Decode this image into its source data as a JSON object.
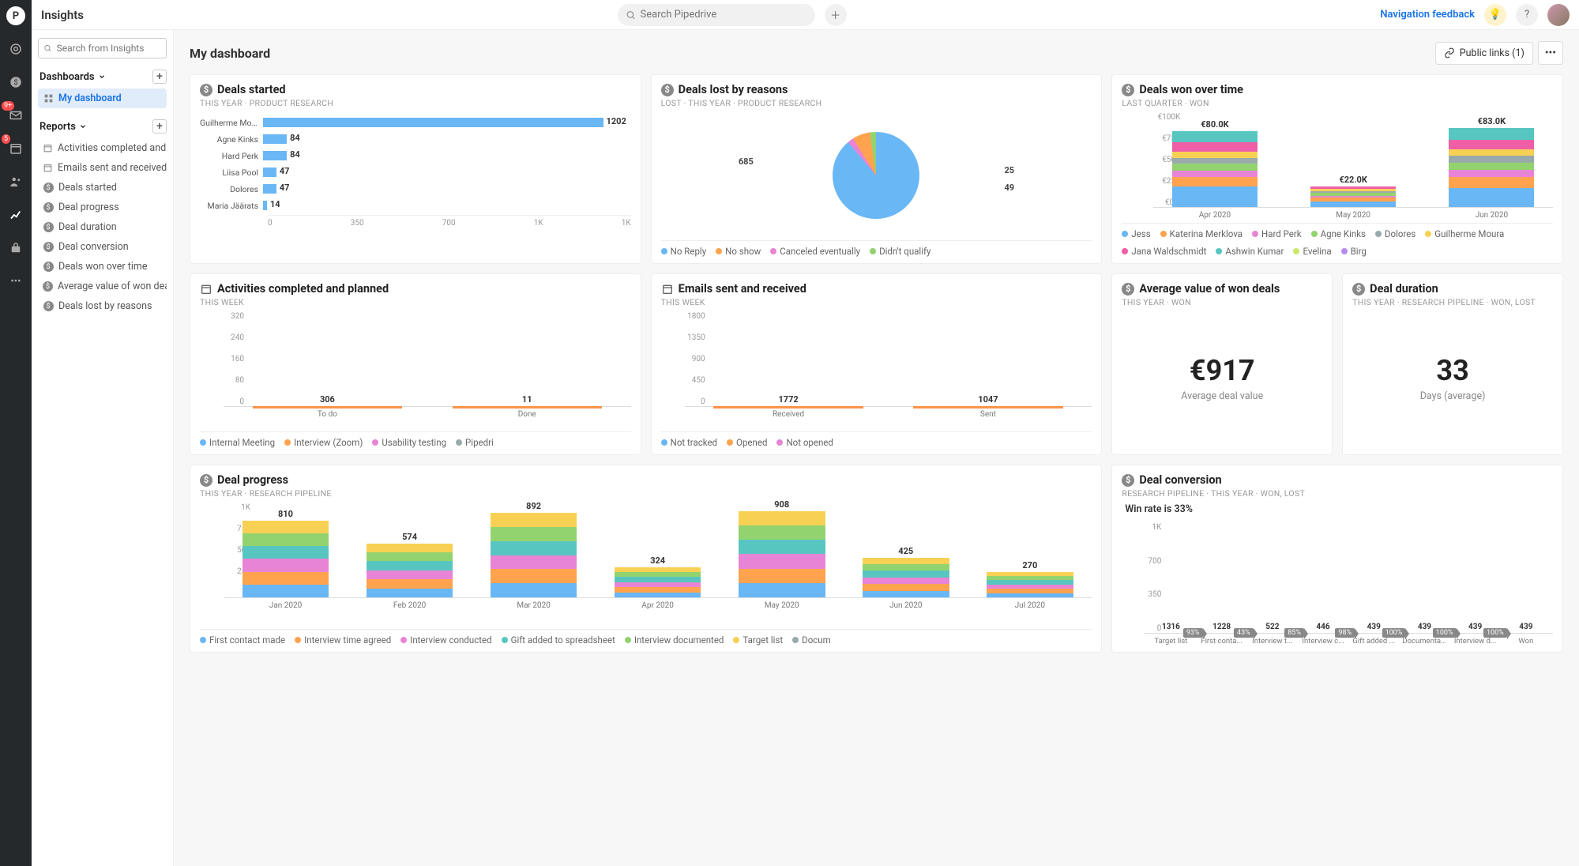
{
  "topbar": {
    "app_title": "Insights",
    "search_placeholder": "Search Pipedrive",
    "feedback": "Navigation feedback",
    "mail_badge": "9+",
    "cal_badge": "5"
  },
  "sidebar": {
    "search_placeholder": "Search from Insights",
    "dashboards_label": "Dashboards",
    "reports_label": "Reports",
    "dashboard_items": [
      {
        "label": "My dashboard",
        "active": true
      }
    ],
    "report_items": [
      {
        "label": "Activities completed and ...",
        "icon": "cal"
      },
      {
        "label": "Emails sent and received",
        "icon": "cal"
      },
      {
        "label": "Deals started",
        "icon": "coin"
      },
      {
        "label": "Deal progress",
        "icon": "coin"
      },
      {
        "label": "Deal duration",
        "icon": "coin"
      },
      {
        "label": "Deal conversion",
        "icon": "coin"
      },
      {
        "label": "Deals won over time",
        "icon": "coin"
      },
      {
        "label": "Average value of won deals",
        "icon": "coin"
      },
      {
        "label": "Deals lost by reasons",
        "icon": "coin"
      }
    ]
  },
  "content": {
    "title": "My dashboard",
    "public_links": "Public links (1)"
  },
  "cards": {
    "deals_started": {
      "title": "Deals started",
      "subtitle": "THIS YEAR   ·   PRODUCT RESEARCH",
      "axis": [
        "0",
        "350",
        "700",
        "1K",
        "1K"
      ],
      "rows": [
        {
          "name": "Guilherme Moura",
          "val": 1202
        },
        {
          "name": "Agne Kinks",
          "val": 84
        },
        {
          "name": "Hard Perk",
          "val": 84
        },
        {
          "name": "Liisa Pool",
          "val": 47
        },
        {
          "name": "Dolores",
          "val": 47
        },
        {
          "name": "Maria Jäärats",
          "val": 14
        }
      ]
    },
    "deals_lost": {
      "title": "Deals lost by reasons",
      "subtitle": "LOST   ·   THIS YEAR   ·   PRODUCT RESEARCH",
      "labels": {
        "a": "685",
        "b": "25",
        "c": "49"
      },
      "legend": [
        {
          "c": "#6ab7f5",
          "t": "No Reply"
        },
        {
          "c": "#ffa34f",
          "t": "No show"
        },
        {
          "c": "#e884d6",
          "t": "Canceled eventually"
        },
        {
          "c": "#93d36f",
          "t": "Didn't qualify"
        }
      ]
    },
    "deals_won": {
      "title": "Deals won over time",
      "subtitle": "LAST QUARTER   ·   WON",
      "ylabels": [
        "€100K",
        "€75K",
        "€50K",
        "€25K",
        "€0.0"
      ],
      "cols": [
        {
          "x": "Apr 2020",
          "val": "€80.0K",
          "h": 80,
          "segs": [
            22,
            10,
            6,
            8,
            6,
            6,
            10,
            12
          ]
        },
        {
          "x": "May 2020",
          "val": "€22.0K",
          "h": 22,
          "segs": [
            6,
            4,
            2,
            3,
            2,
            2,
            3
          ]
        },
        {
          "x": "Jun 2020",
          "val": "€83.0K",
          "h": 83,
          "segs": [
            20,
            12,
            7,
            8,
            7,
            7,
            10,
            12
          ]
        }
      ],
      "legend": [
        {
          "c": "#6ab7f5",
          "t": "Jess"
        },
        {
          "c": "#ffa34f",
          "t": "Katerina Merklova"
        },
        {
          "c": "#e884d6",
          "t": "Hard Perk"
        },
        {
          "c": "#93d36f",
          "t": "Agne Kinks"
        },
        {
          "c": "#9aa",
          "t": "Dolores"
        },
        {
          "c": "#f8d154",
          "t": "Guilherme Moura"
        },
        {
          "c": "#ef5fa7",
          "t": "Jana Waldschmidt"
        },
        {
          "c": "#58c6c0",
          "t": "Ashwin Kumar"
        },
        {
          "c": "#c8e96b",
          "t": "Evelina"
        },
        {
          "c": "#b58cf2",
          "t": "Birg"
        }
      ]
    },
    "activities": {
      "title": "Activities completed and planned",
      "subtitle": "THIS WEEK",
      "ylabels": [
        "320",
        "240",
        "160",
        "80",
        "0"
      ],
      "cols": [
        {
          "x": "To do",
          "val": "306",
          "h": 96
        },
        {
          "x": "Done",
          "val": "11",
          "h": 6
        }
      ],
      "legend": [
        {
          "c": "#6ab7f5",
          "t": "Internal Meeting"
        },
        {
          "c": "#ffa34f",
          "t": "Interview (Zoom)"
        },
        {
          "c": "#e884d6",
          "t": "Usability testing"
        },
        {
          "c": "#9aa",
          "t": "Pipedri"
        }
      ]
    },
    "emails": {
      "title": "Emails sent and received",
      "subtitle": "THIS WEEK",
      "ylabels": [
        "1800",
        "1350",
        "900",
        "450",
        "0"
      ],
      "cols": [
        {
          "x": "Received",
          "val": "1772",
          "h": 98
        },
        {
          "x": "Sent",
          "val": "1047",
          "h": 58
        }
      ],
      "legend": [
        {
          "c": "#6ab7f5",
          "t": "Not tracked"
        },
        {
          "c": "#ffa34f",
          "t": "Opened"
        },
        {
          "c": "#e884d6",
          "t": "Not opened"
        }
      ]
    },
    "avg_value": {
      "title": "Average value of won deals",
      "subtitle": "THIS YEAR   ·   WON",
      "value": "€917",
      "label": "Average deal value"
    },
    "duration": {
      "title": "Deal duration",
      "subtitle": "THIS YEAR   ·   RESEARCH PIPELINE   ·   WON, LOST",
      "value": "33",
      "label": "Days (average)"
    },
    "progress": {
      "title": "Deal progress",
      "subtitle": "THIS YEAR   ·   RESEARCH PIPELINE",
      "ylabels": [
        "1K",
        "750",
        "500",
        "250",
        "0"
      ],
      "cols": [
        {
          "x": "Jan 2020",
          "val": "810",
          "h": 81
        },
        {
          "x": "Feb 2020",
          "val": "574",
          "h": 57
        },
        {
          "x": "Mar 2020",
          "val": "892",
          "h": 89
        },
        {
          "x": "Apr 2020",
          "val": "324",
          "h": 32
        },
        {
          "x": "May 2020",
          "val": "908",
          "h": 91
        },
        {
          "x": "Jun 2020",
          "val": "425",
          "h": 42
        },
        {
          "x": "Jul 2020",
          "val": "270",
          "h": 27
        }
      ],
      "legend": [
        {
          "c": "#6ab7f5",
          "t": "First contact made"
        },
        {
          "c": "#ffa34f",
          "t": "Interview time agreed"
        },
        {
          "c": "#e884d6",
          "t": "Interview conducted"
        },
        {
          "c": "#58c6c0",
          "t": "Gift added to spreadsheet"
        },
        {
          "c": "#93d36f",
          "t": "Interview documented"
        },
        {
          "c": "#f8d154",
          "t": "Target list"
        },
        {
          "c": "#9aa",
          "t": "Docum"
        }
      ]
    },
    "conversion": {
      "title": "Deal conversion",
      "subtitle": "RESEARCH PIPELINE   ·   THIS YEAR   ·   WON, LOST",
      "win_rate": "Win rate is 33%",
      "ylabels": [
        "1K",
        "700",
        "350",
        "0"
      ],
      "cols": [
        {
          "x": "Target list",
          "val": "1316",
          "h": 100,
          "pct": "93%"
        },
        {
          "x": "First conta...",
          "val": "1228",
          "h": 93,
          "pct": "43%"
        },
        {
          "x": "Interview t...",
          "val": "522",
          "h": 40,
          "pct": "85%"
        },
        {
          "x": "Interview c...",
          "val": "446",
          "h": 34,
          "pct": "98%"
        },
        {
          "x": "Gift added ...",
          "val": "439",
          "h": 33,
          "pct": "100%"
        },
        {
          "x": "Documentati...",
          "val": "439",
          "h": 33,
          "pct": "100%"
        },
        {
          "x": "Interview d...",
          "val": "439",
          "h": 33,
          "pct": "100%"
        },
        {
          "x": "Won",
          "val": "439",
          "h": 33,
          "pct": null,
          "green": true
        }
      ]
    }
  },
  "chart_data": [
    {
      "type": "bar",
      "title": "Deals started",
      "orientation": "horizontal",
      "categories": [
        "Guilherme Moura",
        "Agne Kinks",
        "Hard Perk",
        "Liisa Pool",
        "Dolores",
        "Maria Jäärats"
      ],
      "values": [
        1202,
        84,
        84,
        47,
        47,
        14
      ],
      "xlim": [
        0,
        1200
      ]
    },
    {
      "type": "pie",
      "title": "Deals lost by reasons",
      "categories": [
        "No Reply",
        "No show",
        "Canceled eventually",
        "Didn't qualify"
      ],
      "values": [
        685,
        49,
        25,
        0
      ],
      "annotations": [
        "685",
        "25",
        "49"
      ]
    },
    {
      "type": "bar",
      "title": "Deals won over time",
      "stacked": true,
      "categories": [
        "Apr 2020",
        "May 2020",
        "Jun 2020"
      ],
      "totals": [
        80000,
        22000,
        83000
      ],
      "ylabel": "€",
      "ylim": [
        0,
        100000
      ],
      "series_names": [
        "Jess",
        "Katerina Merklova",
        "Hard Perk",
        "Agne Kinks",
        "Dolores",
        "Guilherme Moura",
        "Jana Waldschmidt",
        "Ashwin Kumar",
        "Evelina",
        "Birg"
      ]
    },
    {
      "type": "bar",
      "title": "Activities completed and planned",
      "categories": [
        "To do",
        "Done"
      ],
      "values": [
        306,
        11
      ],
      "ylim": [
        0,
        320
      ],
      "series_names": [
        "Internal Meeting",
        "Interview (Zoom)",
        "Usability testing",
        "Pipedri"
      ]
    },
    {
      "type": "bar",
      "title": "Emails sent and received",
      "categories": [
        "Received",
        "Sent"
      ],
      "values": [
        1772,
        1047
      ],
      "ylim": [
        0,
        1800
      ],
      "series_names": [
        "Not tracked",
        "Opened",
        "Not opened"
      ]
    },
    {
      "type": "scalar",
      "title": "Average value of won deals",
      "value": 917,
      "unit": "€",
      "label": "Average deal value"
    },
    {
      "type": "scalar",
      "title": "Deal duration",
      "value": 33,
      "unit": "days",
      "label": "Days (average)"
    },
    {
      "type": "bar",
      "title": "Deal progress",
      "stacked": true,
      "categories": [
        "Jan 2020",
        "Feb 2020",
        "Mar 2020",
        "Apr 2020",
        "May 2020",
        "Jun 2020",
        "Jul 2020"
      ],
      "totals": [
        810,
        574,
        892,
        324,
        908,
        425,
        270
      ],
      "ylim": [
        0,
        1000
      ],
      "series_names": [
        "First contact made",
        "Interview time agreed",
        "Interview conducted",
        "Gift added to spreadsheet",
        "Interview documented",
        "Target list",
        "Docum"
      ]
    },
    {
      "type": "bar",
      "title": "Deal conversion",
      "subtitle": "Win rate is 33%",
      "categories": [
        "Target list",
        "First contact",
        "Interview time",
        "Interview conducted",
        "Gift added",
        "Documentation",
        "Interview done",
        "Won"
      ],
      "values": [
        1316,
        1228,
        522,
        446,
        439,
        439,
        439,
        439
      ],
      "conversion_pct": [
        93,
        43,
        85,
        98,
        100,
        100,
        100,
        null
      ],
      "ylim": [
        0,
        1316
      ]
    }
  ]
}
